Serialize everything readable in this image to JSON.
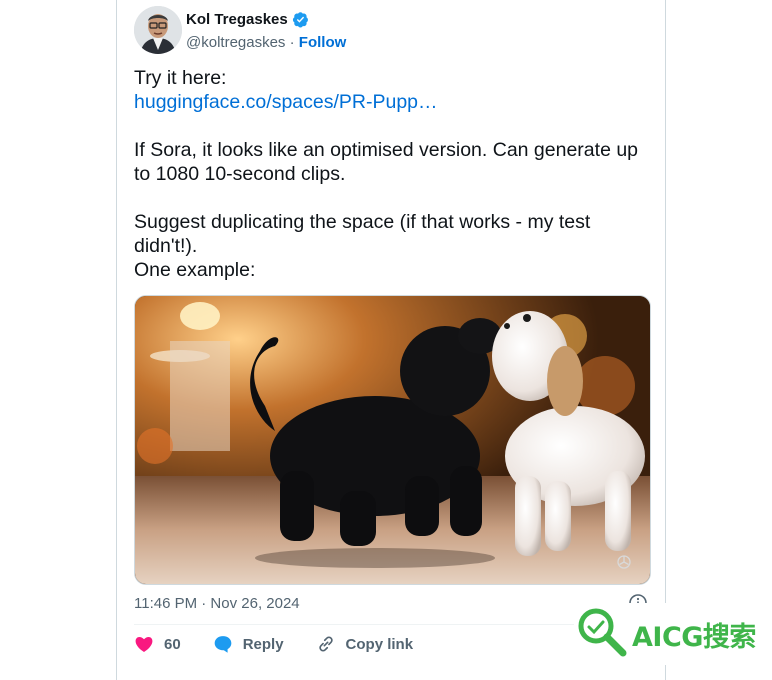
{
  "tweet": {
    "author_name": "Kol Tregaskes",
    "handle": "@koltregaskes",
    "handle_separator": " · ",
    "follow_label": "Follow",
    "lines": {
      "l1": "Try it here:",
      "link": "huggingface.co/spaces/PR-Pupp…",
      "l3": "If Sora, it looks like an optimised version.  Can generate up to 1080 10-second clips.",
      "l4": "Suggest duplicating the space (if that works - my test didn't!).",
      "l5": "One example:"
    },
    "timestamp": "11:46 PM · Nov 26, 2024",
    "likes_count": "60",
    "reply_label": "Reply",
    "copy_link_label": "Copy link"
  },
  "watermark": {
    "text": "AICG搜索"
  },
  "colors": {
    "link": "#006fd6",
    "verified": "#1d9bf0",
    "like": "#f91880",
    "reply": "#1d9bf0",
    "muted": "#536471",
    "watermark": "#3fb54a"
  },
  "icons": [
    "verified-badge-icon",
    "openai-logo-icon",
    "info-icon",
    "heart-icon",
    "reply-icon",
    "link-icon",
    "search-magnifier-icon"
  ]
}
